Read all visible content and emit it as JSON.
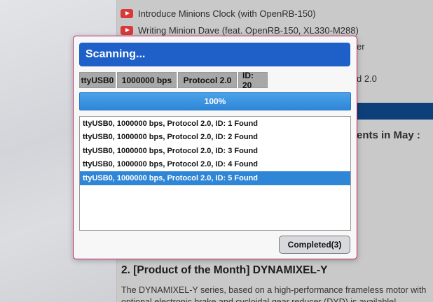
{
  "background": {
    "videos": [
      {
        "icon": "youtube-icon",
        "title": "Introduce Minions Clock (with OpenRB-150)"
      },
      {
        "icon": "youtube-icon",
        "title": "Writing Minion Dave (feat. OpenRB-150, XL330-M288)"
      }
    ],
    "fragment_er": "er",
    "fragment_d20": "d 2.0",
    "fragment_events": "ents in May :",
    "section_heading": "2. [Product of the Month] DYNAMIXEL-Y",
    "section_text": "The DYNAMIXEL-Y series, based on a high-performance frameless motor with optional electronic brake and cycloidal gear reducer (DYD) is available!"
  },
  "dialog": {
    "title": "Scanning...",
    "tags": [
      "ttyUSB0",
      "1000000 bps",
      "Protocol 2.0",
      "ID: 20"
    ],
    "progress": {
      "value": 100,
      "label": "100%"
    },
    "results": [
      "ttyUSB0, 1000000 bps, Protocol 2.0, ID: 1 Found",
      "ttyUSB0, 1000000 bps, Protocol 2.0, ID: 2 Found",
      "ttyUSB0, 1000000 bps, Protocol 2.0, ID: 3 Found",
      "ttyUSB0, 1000000 bps, Protocol 2.0, ID: 4 Found",
      "ttyUSB0, 1000000 bps, Protocol 2.0, ID: 5 Found"
    ],
    "selected_index": 4,
    "completed_button": "Completed(3)"
  },
  "colors": {
    "accent": "#1e60c7",
    "progress": "#2f86d6",
    "dialog_border": "#c0266b",
    "youtube_red": "#d83a3a"
  }
}
